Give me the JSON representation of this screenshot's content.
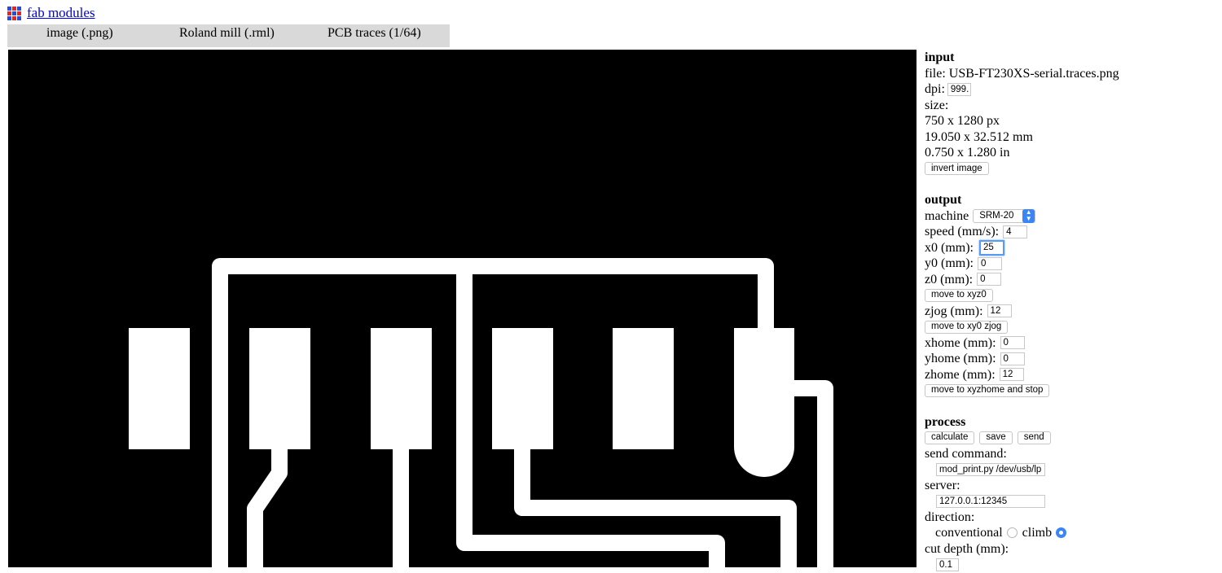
{
  "header": {
    "title": "fab modules",
    "logo_colors": [
      "#2a47e8",
      "#e8242a",
      "#2a47e8",
      "#e8242a",
      "#2a47e8",
      "#e8242a",
      "#2a47e8",
      "#e8242a",
      "#2a47e8"
    ]
  },
  "modules": {
    "tabs": [
      {
        "label": "image (.png)"
      },
      {
        "label": "Roland mill (.rml)"
      },
      {
        "label": "PCB traces (1/64)"
      }
    ]
  },
  "input": {
    "heading": "input",
    "file_label": "file: USB-FT230XS-serial.traces.png",
    "dpi_label": "dpi:",
    "dpi_value": "999.",
    "size_label": "size:",
    "size_px": "750 x 1280 px",
    "size_mm": "19.050 x 32.512 mm",
    "size_in": "0.750 x 1.280 in",
    "invert_button": "invert image"
  },
  "output": {
    "heading": "output",
    "machine_label": "machine",
    "machine_value": "SRM-20",
    "speed_label": "speed (mm/s):",
    "speed_value": "4",
    "x0_label": "x0 (mm):",
    "x0_value": "25",
    "y0_label": "y0 (mm):",
    "y0_value": "0",
    "z0_label": "z0 (mm):",
    "z0_value": "0",
    "move_xyz0_button": "move to xyz0",
    "zjog_label": "zjog (mm):",
    "zjog_value": "12",
    "move_xy0_zjog_button": "move to xy0 zjog",
    "xhome_label": "xhome (mm):",
    "xhome_value": "0",
    "yhome_label": "yhome (mm):",
    "yhome_value": "0",
    "zhome_label": "zhome (mm):",
    "zhome_value": "12",
    "move_home_button": "move to xyzhome and stop"
  },
  "process": {
    "heading": "process",
    "calculate_button": "calculate",
    "save_button": "save",
    "send_button": "send",
    "send_command_label": "send command:",
    "send_command_value": "mod_print.py /dev/usb/lp",
    "server_label": "server:",
    "server_value": "127.0.0.1:12345",
    "direction_label": "direction:",
    "conventional_label": "conventional",
    "climb_label": "climb",
    "direction_selected": "climb",
    "cut_depth_label": "cut depth (mm):",
    "cut_depth_value": "0.1"
  },
  "colors": {
    "canvas_background": "#000000",
    "trace": "#ffffff",
    "module_bar": "#d9d9d9",
    "link": "#0000ee",
    "accent": "#3b86f7"
  }
}
